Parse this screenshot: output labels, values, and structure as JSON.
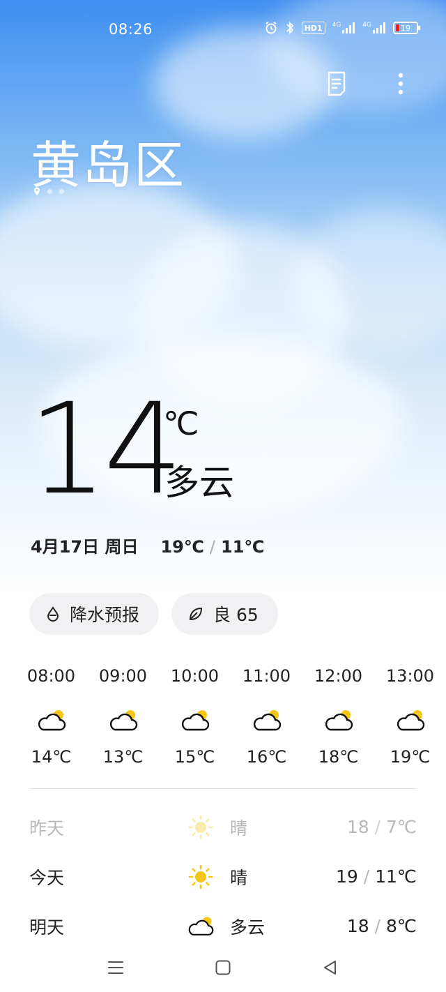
{
  "status_bar": {
    "time": "08:26",
    "icons": [
      "alarm-icon",
      "bluetooth-icon",
      "hd-icon",
      "signal-4g-icon",
      "signal-4g-icon"
    ],
    "hd_label": "HD1",
    "network_1": "4G",
    "network_2": "4G",
    "battery_percent": "19",
    "battery_color": "#e02b2b"
  },
  "header": {
    "actions": [
      "list-icon",
      "more-vertical-icon"
    ]
  },
  "location": {
    "city": "黄岛区",
    "pages": 3,
    "active_page": 1
  },
  "current": {
    "temperature": "14",
    "unit": "℃",
    "condition": "多云",
    "date": "4月17日 周日",
    "high": "19℃",
    "separator": "/",
    "low": "11℃"
  },
  "chips": {
    "precipitation": "降水预报",
    "air_quality": "良 65"
  },
  "hourly": [
    {
      "time": "08:00",
      "icon": "partly-cloudy-icon",
      "temp": "14℃"
    },
    {
      "time": "09:00",
      "icon": "partly-cloudy-icon",
      "temp": "13℃"
    },
    {
      "time": "10:00",
      "icon": "partly-cloudy-icon",
      "temp": "15℃"
    },
    {
      "time": "11:00",
      "icon": "partly-cloudy-icon",
      "temp": "16℃"
    },
    {
      "time": "12:00",
      "icon": "partly-cloudy-icon",
      "temp": "18℃"
    },
    {
      "time": "13:00",
      "icon": "partly-cloudy-icon",
      "temp": "19℃"
    }
  ],
  "daily": [
    {
      "day": "昨天",
      "icon": "sunny-icon",
      "condition": "晴",
      "high": "18",
      "sep": "/",
      "low": "7℃",
      "past": true
    },
    {
      "day": "今天",
      "icon": "sunny-icon",
      "condition": "晴",
      "high": "19",
      "sep": "/",
      "low": "11℃",
      "past": false
    },
    {
      "day": "明天",
      "icon": "partly-cloudy-icon",
      "condition": "多云",
      "high": "18",
      "sep": "/",
      "low": "8℃",
      "past": false
    }
  ],
  "colors": {
    "sky_top": "#3f8ff0",
    "sun": "#f5c518",
    "text": "#111111",
    "muted": "#b8b8b8"
  },
  "navbar": [
    "menu-icon",
    "home-icon",
    "back-icon"
  ]
}
